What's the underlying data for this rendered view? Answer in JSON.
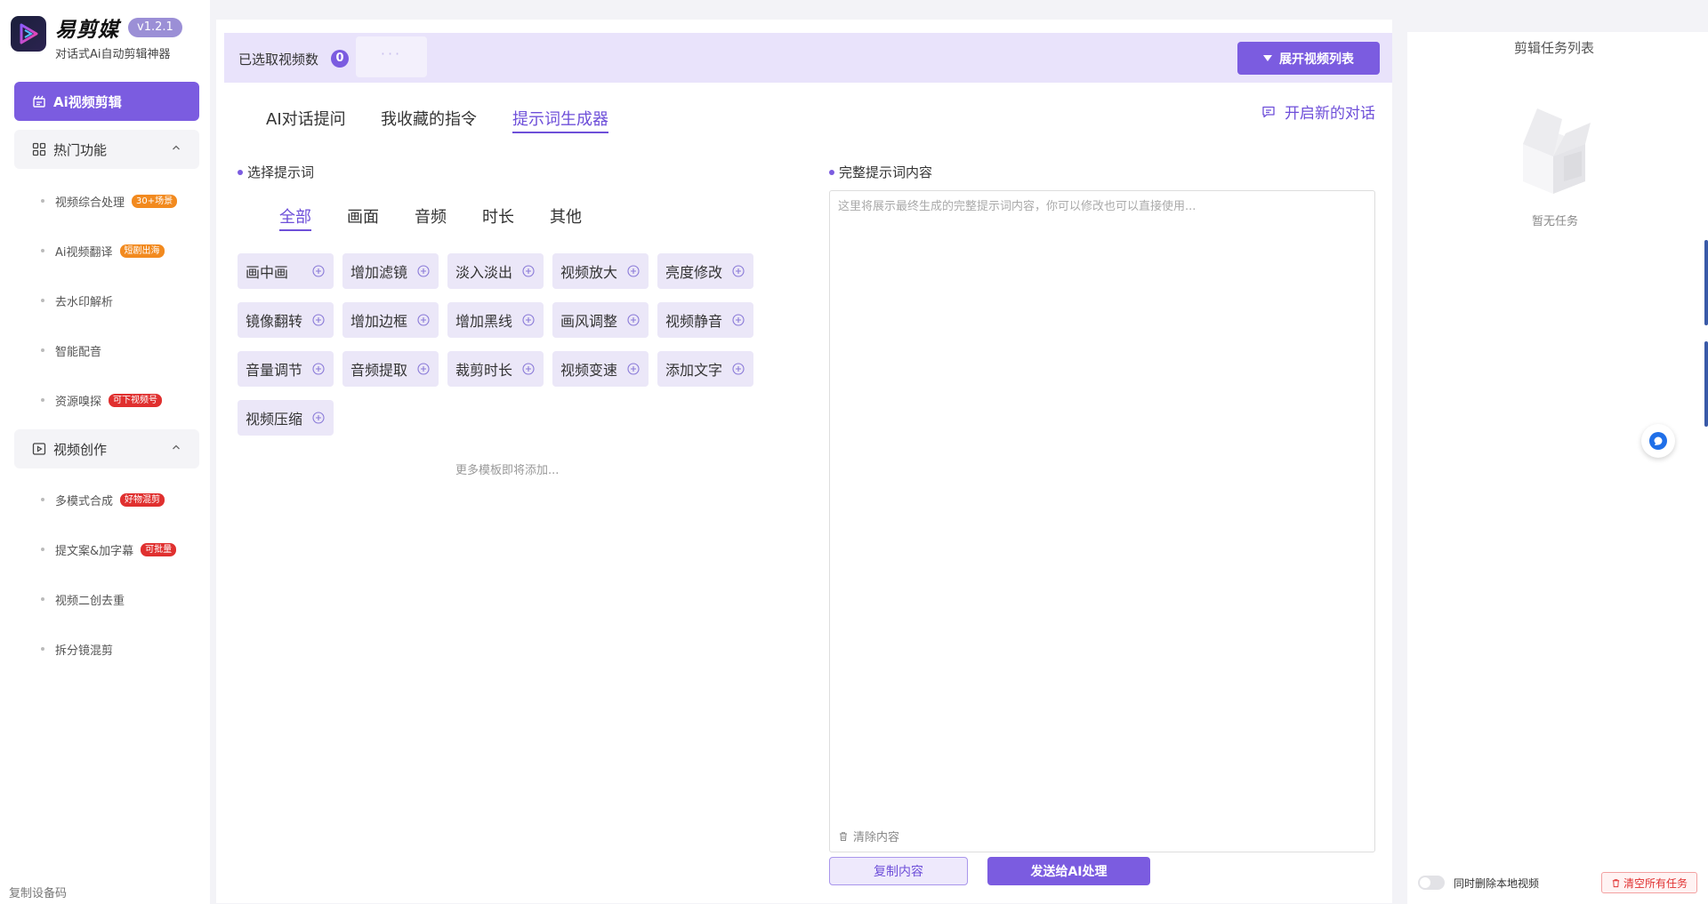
{
  "brand": {
    "name": "易剪媒",
    "version": "v1.2.1",
    "tagline": "对话式Ai自动剪辑神器"
  },
  "sidebar": {
    "primary_label": "Ai视频剪辑",
    "groups": [
      {
        "label": "热门功能",
        "items": [
          {
            "label": "视频综合处理",
            "badge": "30+场景",
            "badge_color": "orange"
          },
          {
            "label": "Ai视频翻译",
            "badge": "短剧出海",
            "badge_color": "orange"
          },
          {
            "label": "去水印解析",
            "badge": ""
          },
          {
            "label": "智能配音",
            "badge": ""
          },
          {
            "label": "资源嗅探",
            "badge": "可下视频号",
            "badge_color": "red"
          }
        ]
      },
      {
        "label": "视频创作",
        "items": [
          {
            "label": "多模式合成",
            "badge": "好物混剪",
            "badge_color": "red"
          },
          {
            "label": "提文案&加字幕",
            "badge": "可批量",
            "badge_color": "red"
          },
          {
            "label": "视频二创去重",
            "badge": ""
          },
          {
            "label": "拆分镜混剪",
            "badge": ""
          }
        ]
      }
    ],
    "device_code": "复制设备码"
  },
  "topbar": {
    "selected_label": "已选取视频数",
    "selected_count": "0",
    "thumb_placeholder": "···",
    "expand_label": "展开视频列表"
  },
  "tabs": [
    {
      "label": "AI对话提问"
    },
    {
      "label": "我收藏的指令"
    },
    {
      "label": "提示词生成器"
    }
  ],
  "new_chat": "开启新的对话",
  "select_section": {
    "title": "选择提示词",
    "categories": [
      "全部",
      "画面",
      "音频",
      "时长",
      "其他"
    ],
    "chips": [
      "画中画",
      "增加滤镜",
      "淡入淡出",
      "视频放大",
      "亮度修改",
      "镜像翻转",
      "增加边框",
      "增加黑线",
      "画风调整",
      "视频静音",
      "音量调节",
      "音频提取",
      "裁剪时长",
      "视频变速",
      "添加文字",
      "视频压缩"
    ],
    "more_hint": "更多模板即将添加..."
  },
  "content_section": {
    "title": "完整提示词内容",
    "placeholder": "这里将展示最终生成的完整提示词内容，你可以修改也可以直接使用...",
    "clear_label": "清除内容",
    "copy_label": "复制内容",
    "send_label": "发送给AI处理"
  },
  "task_panel": {
    "title": "剪辑任务列表",
    "empty_text": "暂无任务",
    "delete_local_label": "同时删除本地视频",
    "delete_local_on": false,
    "clear_all_label": "清空所有任务"
  },
  "colors": {
    "accent": "#7b5ce0",
    "accent_light": "#e9e3fb",
    "danger": "#e03030"
  }
}
